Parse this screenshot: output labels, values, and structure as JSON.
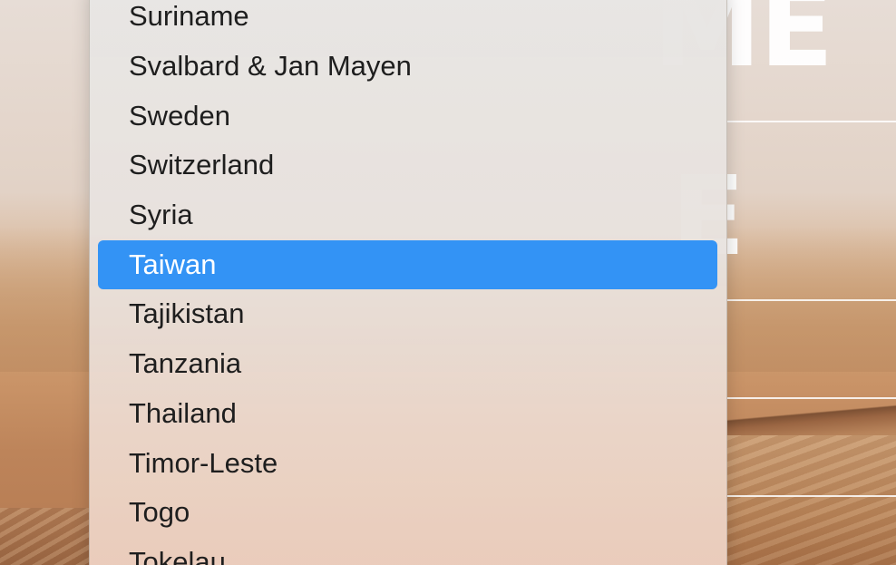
{
  "background": {
    "big_letters_top": "ME",
    "big_letters_mid": "E"
  },
  "country_menu": {
    "items": [
      {
        "label": "Suriname",
        "selected": false
      },
      {
        "label": "Svalbard & Jan Mayen",
        "selected": false
      },
      {
        "label": "Sweden",
        "selected": false
      },
      {
        "label": "Switzerland",
        "selected": false
      },
      {
        "label": "Syria",
        "selected": false
      },
      {
        "label": "Taiwan",
        "selected": true
      },
      {
        "label": "Tajikistan",
        "selected": false
      },
      {
        "label": "Tanzania",
        "selected": false
      },
      {
        "label": "Thailand",
        "selected": false
      },
      {
        "label": "Timor-Leste",
        "selected": false
      },
      {
        "label": "Togo",
        "selected": false
      },
      {
        "label": "Tokelau",
        "selected": false
      }
    ],
    "selected_color": "#3393f5"
  }
}
